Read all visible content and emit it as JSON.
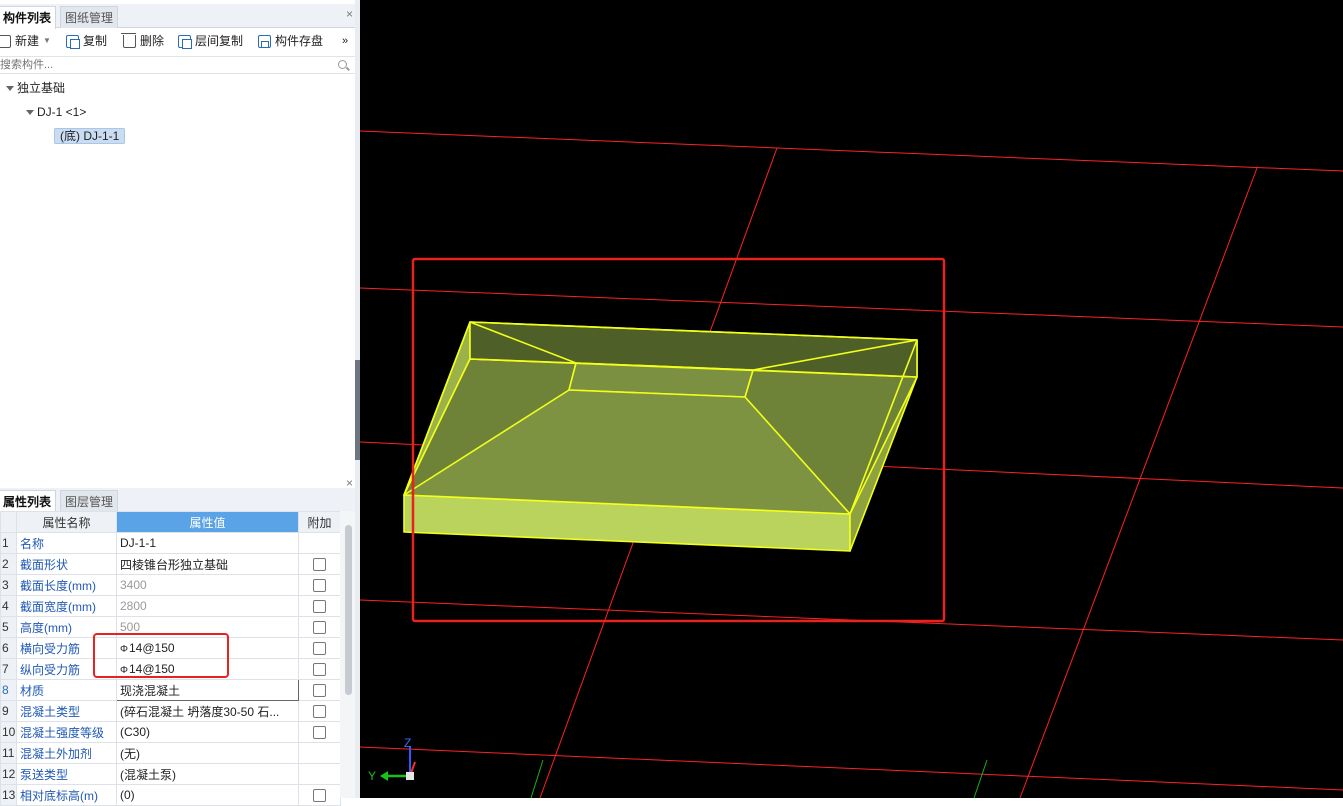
{
  "component_panel": {
    "tabs": [
      {
        "label": "构件列表",
        "active": true
      },
      {
        "label": "图纸管理",
        "active": false
      }
    ],
    "close": "×",
    "toolbar": {
      "new": "新建",
      "copy": "复制",
      "delete": "删除",
      "floor_copy": "层间复制",
      "save": "构件存盘",
      "more": "»"
    },
    "search_placeholder": "搜索构件...",
    "tree": {
      "root": "独立基础",
      "child": "DJ-1 <1>",
      "leaf": "(底) DJ-1-1"
    }
  },
  "property_panel": {
    "tabs": [
      {
        "label": "属性列表",
        "active": true
      },
      {
        "label": "图层管理",
        "active": false
      }
    ],
    "close": "×",
    "headers": {
      "index": "",
      "name": "属性名称",
      "value": "属性值",
      "attach": "附加"
    },
    "rows": [
      {
        "idx": "1",
        "name": "名称",
        "value": "DJ-1-1",
        "checkbox": false,
        "grey": false
      },
      {
        "idx": "2",
        "name": "截面形状",
        "value": "四棱锥台形独立基础",
        "checkbox": true,
        "grey": false
      },
      {
        "idx": "3",
        "name": "截面长度(mm)",
        "value": "3400",
        "checkbox": true,
        "grey": true
      },
      {
        "idx": "4",
        "name": "截面宽度(mm)",
        "value": "2800",
        "checkbox": true,
        "grey": true
      },
      {
        "idx": "5",
        "name": "高度(mm)",
        "value": "500",
        "checkbox": true,
        "grey": true
      },
      {
        "idx": "6",
        "name": "横向受力筋",
        "value": "14@150",
        "rebar": "Φ",
        "checkbox": true,
        "grey": false
      },
      {
        "idx": "7",
        "name": "纵向受力筋",
        "value": "14@150",
        "rebar": "Φ",
        "checkbox": true,
        "grey": false
      },
      {
        "idx": "8",
        "name": "材质",
        "value": "现浇混凝土",
        "checkbox": true,
        "grey": false,
        "selected": true
      },
      {
        "idx": "9",
        "name": "混凝土类型",
        "value": "(碎石混凝土 坍落度30-50 石...",
        "checkbox": true,
        "grey": false
      },
      {
        "idx": "10",
        "name": "混凝土强度等级",
        "value": "(C30)",
        "checkbox": true,
        "grey": false
      },
      {
        "idx": "11",
        "name": "混凝土外加剂",
        "value": "(无)",
        "checkbox": false,
        "grey": false
      },
      {
        "idx": "12",
        "name": "泵送类型",
        "value": "(混凝土泵)",
        "checkbox": false,
        "grey": false
      },
      {
        "idx": "13",
        "name": "相对底标高(m)",
        "value": "(0)",
        "checkbox": true,
        "grey": false
      }
    ]
  },
  "viewport": {
    "axis_z": "Z",
    "axis_y": "Y",
    "background": "#000000",
    "grid_color": "#ff2020",
    "solid_color": "#c8e05a",
    "edge_color": "#f2ff1a",
    "highlight_color": "#e8231f"
  }
}
